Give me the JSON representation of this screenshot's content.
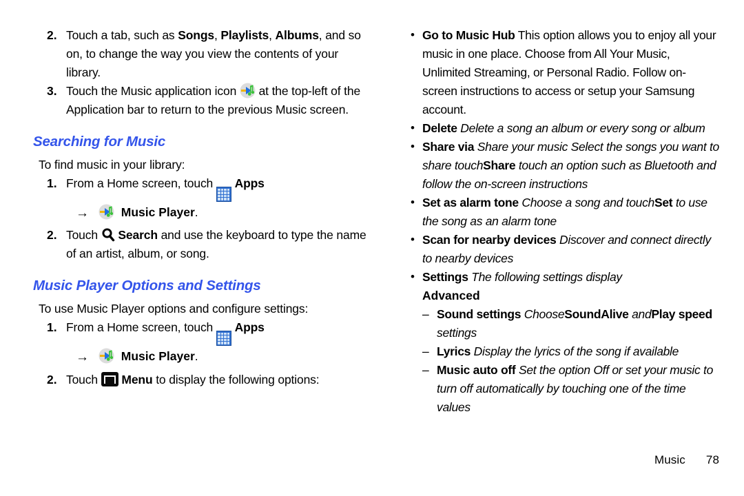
{
  "document": {
    "footer": {
      "section": "Music",
      "page_number": "78"
    },
    "accent_heading_color": "#3354ea"
  },
  "left_column": {
    "steps_top": [
      {
        "number": "2.",
        "segments": [
          {
            "text": "Touch a tab, such as ",
            "style": "normal"
          },
          {
            "text": "Songs",
            "style": "bold"
          },
          {
            "text": ", ",
            "style": "normal"
          },
          {
            "text": "Playlists",
            "style": "bold"
          },
          {
            "text": ", ",
            "style": "normal"
          },
          {
            "text": "Albums",
            "style": "bold"
          },
          {
            "text": ", and so on, to change the way you view the contents of your library.",
            "style": "normal"
          }
        ]
      },
      {
        "number": "3.",
        "segments": [
          {
            "text": "Touch the Music application icon ",
            "style": "normal"
          },
          {
            "text": "",
            "style": "icon",
            "icon": "music-player-icon"
          },
          {
            "text": " at the top-left of the Application bar to return to the previous Music screen.",
            "style": "normal"
          }
        ]
      }
    ],
    "section_searching": {
      "heading": "Searching for Music",
      "lead_in": "To find music in your library:",
      "step1_number": "1.",
      "step1_text": "From a Home screen, touch",
      "step1_apps_label": "Apps",
      "step1_arrow": "→",
      "step1_target_label": "Music Player",
      "step1_period": ".",
      "step2_number": "2.",
      "step2_pre": "Touch",
      "step2_search_label": "Search",
      "step2_post": " and use the keyboard to type the name of an artist, album, or song."
    },
    "section_options": {
      "heading": "Music Player Options and Settings",
      "lead_in": "To use Music Player options and configure settings:",
      "step1_number": "1.",
      "step1_text": "From a Home screen, touch",
      "step1_apps_label": "Apps",
      "step1_arrow": "→",
      "step1_target_label": "Music Player",
      "step1_period": ".",
      "step2_number": "2.",
      "step2_pre": "Touch",
      "step2_menu_label": "Menu",
      "step2_post": " to display the following options:"
    }
  },
  "right_column": {
    "bullets": [
      {
        "marker": "•",
        "segments": [
          {
            "text": "Go to Music Hub",
            "style": "bold"
          },
          {
            "text": "  This option allows you to enjoy all your music in one place. Choose from All Your Music, Unlimited Streaming, or Personal Radio. Follow on-screen instructions to access or setup your Samsung account.",
            "style": "normal"
          }
        ]
      },
      {
        "marker": "•",
        "segments": [
          {
            "text": "Delete",
            "style": "bold"
          },
          {
            "text": "  Delete a song  an album  or every song or album",
            "style": "italic"
          }
        ]
      },
      {
        "marker": "•",
        "segments": [
          {
            "text": "Share via",
            "style": "bold"
          },
          {
            "text": "  Share your music  Select the songs you want to share  touch",
            "style": "italic"
          },
          {
            "text": "Share",
            "style": "bold"
          },
          {
            "text": "  touch an option  such as Bluetooth  and follow the on-screen instructions",
            "style": "italic"
          }
        ]
      },
      {
        "marker": "•",
        "segments": [
          {
            "text": "Set as alarm tone",
            "style": "bold"
          },
          {
            "text": "  Choose a song and touch",
            "style": "italic"
          },
          {
            "text": "Set",
            "style": "bold"
          },
          {
            "text": " to use the song as an alarm tone",
            "style": "italic"
          }
        ]
      },
      {
        "marker": "•",
        "segments": [
          {
            "text": "Scan for nearby devices",
            "style": "bold"
          },
          {
            "text": "  Discover and connect directly to nearby devices",
            "style": "italic"
          }
        ]
      },
      {
        "marker": "•",
        "segments": [
          {
            "text": "Settings",
            "style": "bold"
          },
          {
            "text": "  The following settings display",
            "style": "italic"
          }
        ]
      }
    ],
    "sub_head": "Advanced",
    "dash_items": [
      {
        "marker": "–",
        "segments": [
          {
            "text": "Sound settings",
            "style": "bold"
          },
          {
            "text": "  Choose",
            "style": "italic"
          },
          {
            "text": "SoundAlive",
            "style": "bold"
          },
          {
            "text": " and",
            "style": "italic"
          },
          {
            "text": "Play speed",
            "style": "bold"
          },
          {
            "text": " settings",
            "style": "italic"
          }
        ]
      },
      {
        "marker": "–",
        "segments": [
          {
            "text": "Lyrics",
            "style": "bold"
          },
          {
            "text": "  Display the lyrics of the song  if available",
            "style": "italic"
          }
        ]
      },
      {
        "marker": "–",
        "segments": [
          {
            "text": "Music auto off",
            "style": "bold"
          },
          {
            "text": "  Set the option Off or set your music to turn off automatically by touching one of the time values",
            "style": "italic"
          }
        ]
      }
    ]
  }
}
